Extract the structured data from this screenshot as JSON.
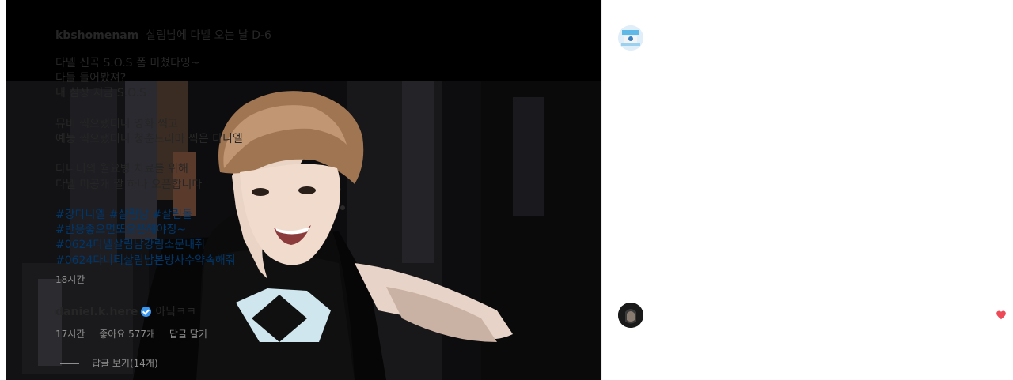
{
  "post": {
    "username": "kbshomenam",
    "title": "살림남에 다녤 오는 날 D-6",
    "lines": [
      "다녤 신곡 S.O.S 폼 미쳤다잉~",
      "다들 들어봤져?",
      "내 심장 지금 S.O.S",
      "",
      "뮤비 찍으랬더니 영화 찍고",
      "예능 찍으랬더니 청춘드라마 찍은 다니엘",
      "",
      "다니티의 월요병 치료를 위해",
      "다녤 미공개 짤 하나 오픈합니다",
      ""
    ],
    "hashtags_line1": "#강다니엘 #살림남 #살림돌",
    "hashtags_line2": "#반응좋으면또오픈해야징~",
    "hashtags_line3": "#0624다녤살림남강림소문내줘",
    "hashtags_line4": "#0624다니티살림남본방사수약속해줘",
    "time": "18시간"
  },
  "comment": {
    "username": "daniel.k.here",
    "text": "아닠ㅋㅋ",
    "time": "17시간",
    "likes": "좋아요 577개",
    "reply_label": "답글 달기",
    "view_replies": "답글 보기(14개)"
  },
  "icons": {
    "verified": "verified-badge-icon",
    "like": "heart-icon"
  },
  "colors": {
    "hashtag": "#00376b",
    "verified": "#3897f0",
    "heart": "#ed4956",
    "meta": "#8e8e8e"
  }
}
